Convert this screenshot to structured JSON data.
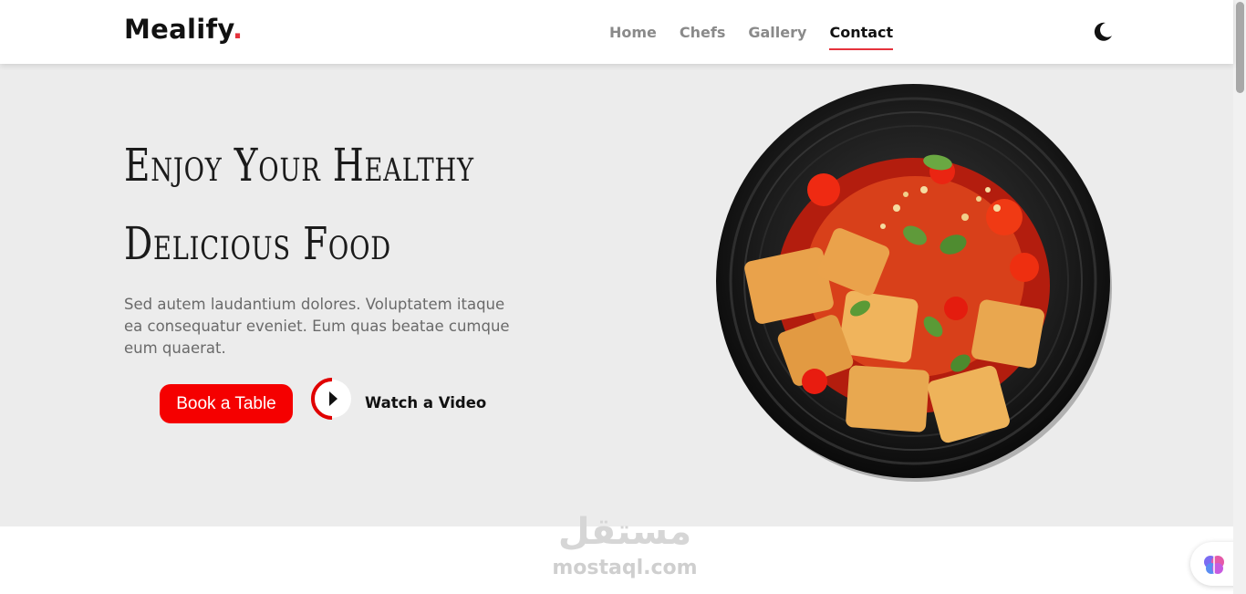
{
  "header": {
    "logo_text": "Mealify",
    "logo_dot": ".",
    "nav": [
      {
        "label": "Home",
        "active": false
      },
      {
        "label": "Chefs",
        "active": false
      },
      {
        "label": "Gallery",
        "active": false
      },
      {
        "label": "Contact",
        "active": true
      }
    ],
    "theme_toggle_icon": "moon-icon"
  },
  "hero": {
    "title_line1": "Enjoy Your Healthy",
    "title_line2": "Delicious Food",
    "description": "Sed autem laudantium dolores. Voluptatem itaque ea consequatur eveniet. Eum quas beatae cumque eum quaerat.",
    "book_button": "Book a Table",
    "watch_label": "Watch a Video",
    "play_icon": "play-icon",
    "image": "food-plate-image"
  },
  "watermark": {
    "arabic": "مستقل",
    "latin": "mostaql.com"
  },
  "floating": {
    "icon": "brain-icon"
  },
  "colors": {
    "accent": "#e5333d",
    "button": "#f50000",
    "hero_bg": "#ececec"
  }
}
